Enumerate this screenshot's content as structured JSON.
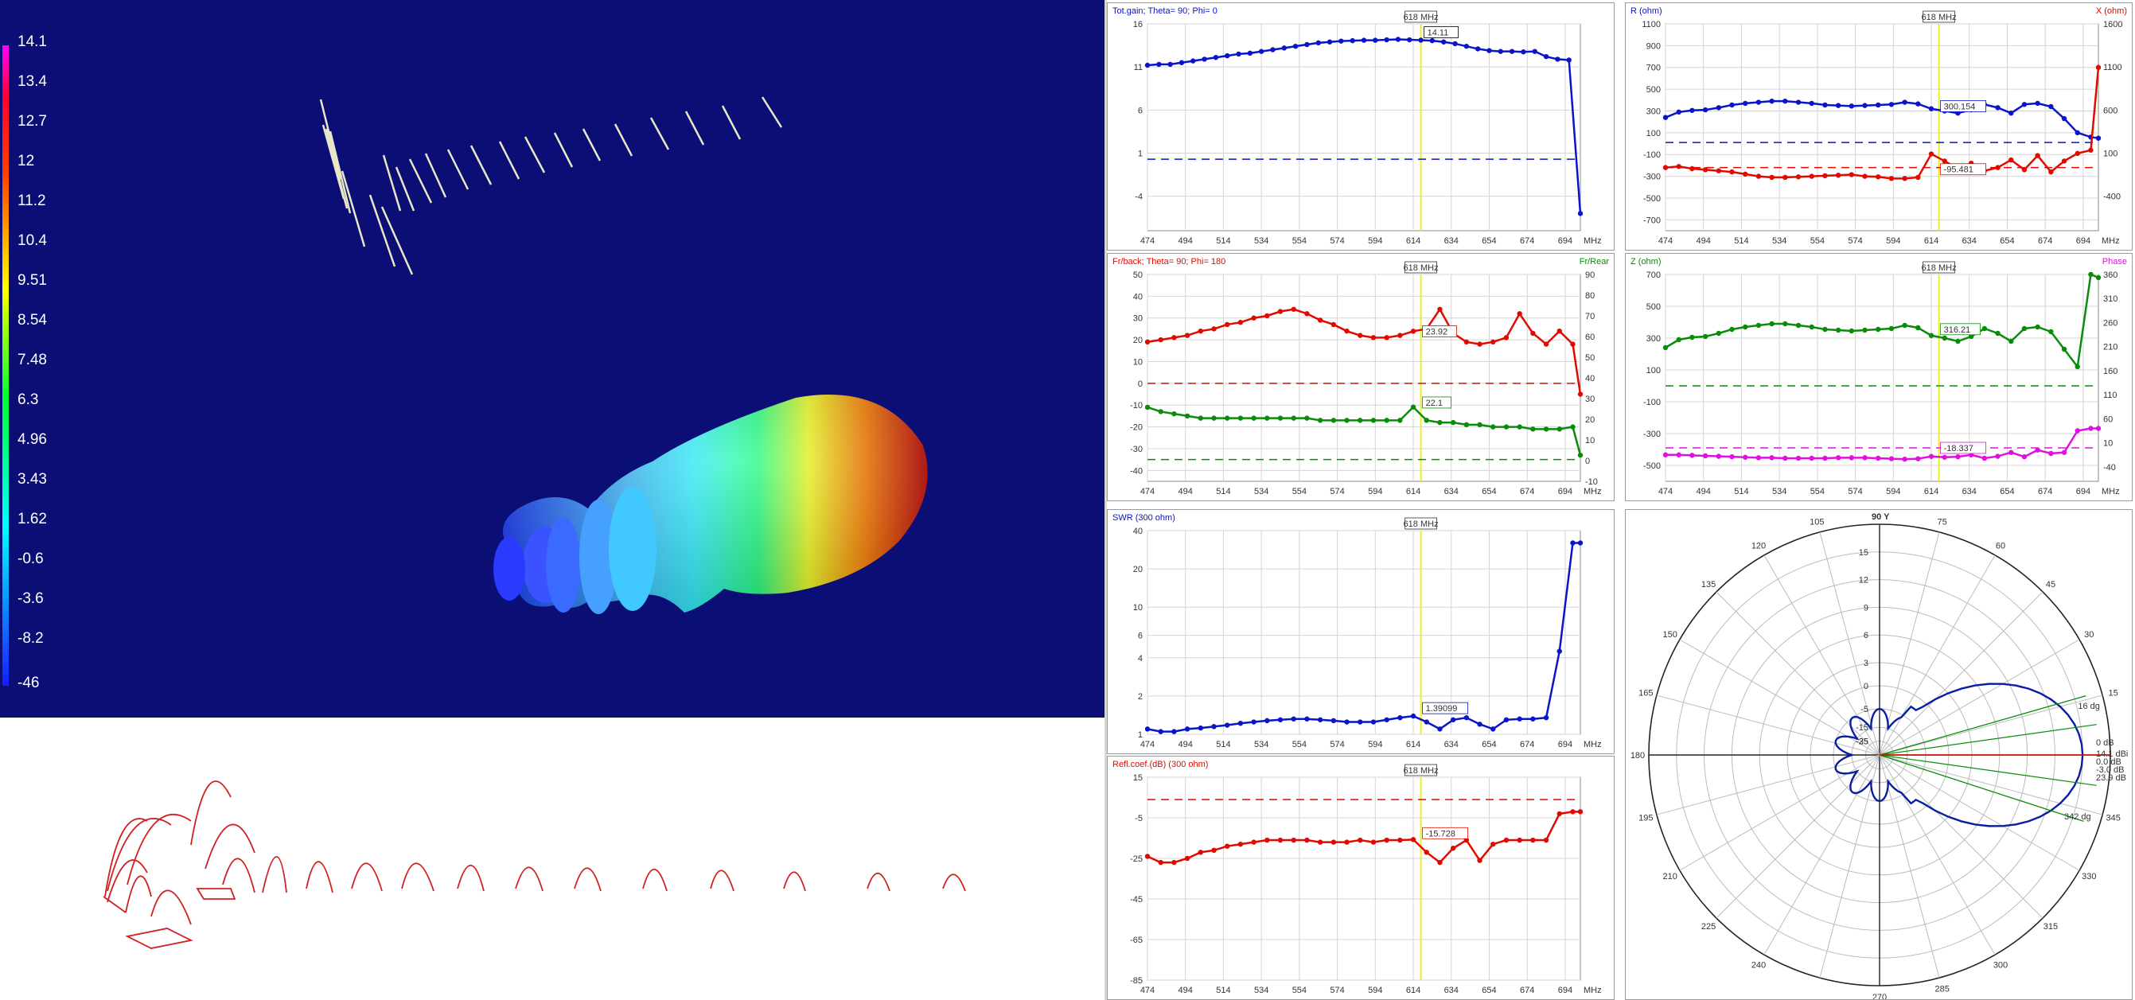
{
  "colors": {
    "background3d": "#0b0e75",
    "blue_series": "#0a14c8",
    "red_series": "#e00a00",
    "green_series": "#0a8c0a",
    "magenta_series": "#e010e0",
    "marker_line": "#f0f020",
    "pattern": "#0a1ea0",
    "wire": "#d02020"
  },
  "colorbar": {
    "labels": [
      "14.1",
      "13.4",
      "12.7",
      "12",
      "11.2",
      "10.4",
      "9.51",
      "8.54",
      "7.48",
      "6.3",
      "4.96",
      "3.43",
      "1.62",
      "-0.6",
      "-3.6",
      "-8.2",
      "-46"
    ]
  },
  "x_axis": {
    "ticks": [
      "474",
      "494",
      "514",
      "534",
      "554",
      "574",
      "594",
      "614",
      "634",
      "654",
      "674",
      "694"
    ],
    "unit": "MHz",
    "marker_label": "618 MHz"
  },
  "panels": {
    "gain": {
      "title": "Tot.gain; Theta= 90; Phi= 0",
      "y_ticks": [
        "16",
        "11",
        "6",
        "1",
        "-4"
      ],
      "readout": "14.11"
    },
    "rx": {
      "title": "R (ohm)",
      "title_right": "X (ohm)",
      "y_ticks_left": [
        "1100",
        "900",
        "700",
        "500",
        "300",
        "100",
        "-100",
        "-300",
        "-500",
        "-700"
      ],
      "y_ticks_right": [
        "1600",
        "1100",
        "600",
        "100",
        "-400"
      ],
      "readout_r": "300.154",
      "readout_x": "-95.481"
    },
    "frback": {
      "title": "Fr/back; Theta= 90; Phi= 180",
      "title_right": "Fr/Rear",
      "y_ticks_left": [
        "50",
        "40",
        "30",
        "20",
        "10",
        "0",
        "-10",
        "-20",
        "-30",
        "-40"
      ],
      "y_ticks_right": [
        "90",
        "80",
        "70",
        "60",
        "50",
        "40",
        "30",
        "20",
        "10",
        "0",
        "-10"
      ],
      "readout_fb": "23.92",
      "readout_fr": "22.1"
    },
    "zphase": {
      "title": "Z (ohm)",
      "title_right": "Phase",
      "y_ticks_left": [
        "700",
        "500",
        "300",
        "100",
        "-100",
        "-300",
        "-500"
      ],
      "y_ticks_right": [
        "360",
        "310",
        "260",
        "210",
        "160",
        "110",
        "60",
        "10",
        "-40"
      ],
      "readout_z": "316.21",
      "readout_phase": "-18.337"
    },
    "swr": {
      "title": "SWR (300 ohm)",
      "y_ticks": [
        "40",
        "20",
        "10",
        "6",
        "4",
        "2",
        "1"
      ],
      "readout": "1.39099"
    },
    "refl": {
      "title": "Refl.coef.(dB) (300 ohm)",
      "y_ticks": [
        "15",
        "-5",
        "-25",
        "-45",
        "-65",
        "-85"
      ],
      "readout": "-15.728"
    },
    "polar": {
      "header": "90 Y",
      "angle_labels": [
        "105",
        "75",
        "120",
        "60",
        "135",
        "45",
        "150",
        "30",
        "165",
        "15",
        "180",
        "195",
        "345",
        "210",
        "330",
        "225",
        "315",
        "240",
        "300",
        "285",
        "270"
      ],
      "radial_labels": [
        "15",
        "12",
        "9",
        "6",
        "3",
        "0",
        "-5",
        "-15",
        "-25",
        "-35"
      ],
      "readouts": [
        "0 dB",
        "14.1 dBi",
        "0.0 dB",
        "-3.0 dB",
        "16 dg",
        "342 dg",
        "23.9 dB"
      ]
    }
  },
  "chart_data": [
    {
      "type": "line",
      "title": "Tot.gain; Theta= 90; Phi= 0",
      "xlabel": "MHz",
      "x": [
        474,
        480,
        486,
        492,
        498,
        504,
        510,
        516,
        522,
        528,
        534,
        540,
        546,
        552,
        558,
        564,
        570,
        576,
        582,
        588,
        594,
        600,
        606,
        612,
        618,
        624,
        630,
        636,
        642,
        648,
        654,
        660,
        666,
        672,
        678,
        684,
        690,
        696,
        702
      ],
      "series": [
        {
          "values": [
            11.2,
            11.3,
            11.3,
            11.5,
            11.7,
            11.9,
            12.1,
            12.3,
            12.5,
            12.6,
            12.8,
            13.0,
            13.2,
            13.4,
            13.6,
            13.8,
            13.9,
            14.0,
            14.05,
            14.1,
            14.1,
            14.15,
            14.2,
            14.15,
            14.11,
            14.05,
            13.9,
            13.7,
            13.4,
            13.1,
            12.9,
            12.8,
            12.8,
            12.75,
            12.8,
            12.2,
            11.9,
            11.8,
            -6.0
          ]
        }
      ],
      "ylim": [
        -8,
        16
      ]
    },
    {
      "type": "line",
      "title": "R (ohm) / X (ohm)",
      "xlabel": "MHz",
      "x": [
        474,
        481,
        488,
        495,
        502,
        509,
        516,
        523,
        530,
        537,
        544,
        551,
        558,
        565,
        572,
        579,
        586,
        593,
        600,
        607,
        614,
        621,
        628,
        635,
        642,
        649,
        656,
        663,
        670,
        677,
        684,
        691,
        698,
        702
      ],
      "series": [
        {
          "name": "R (ohm)",
          "values": [
            240,
            290,
            305,
            310,
            330,
            355,
            370,
            380,
            390,
            390,
            380,
            370,
            355,
            350,
            345,
            350,
            355,
            360,
            380,
            365,
            320,
            300,
            280,
            310,
            360,
            330,
            280,
            360,
            370,
            340,
            230,
            100,
            60,
            50
          ]
        },
        {
          "name": "X (ohm)",
          "values": [
            -220,
            -210,
            -230,
            -240,
            -250,
            -260,
            -280,
            -300,
            -310,
            -310,
            -305,
            -300,
            -295,
            -290,
            -285,
            -300,
            -305,
            -320,
            -320,
            -310,
            -95,
            -160,
            -230,
            -180,
            -250,
            -220,
            -150,
            -240,
            -110,
            -260,
            -160,
            -90,
            -60,
            700
          ]
        }
      ]
    },
    {
      "type": "line",
      "title": "Fr/back; Theta= 90; Phi= 180",
      "xlabel": "MHz",
      "x": [
        474,
        481,
        488,
        495,
        502,
        509,
        516,
        523,
        530,
        537,
        544,
        551,
        558,
        565,
        572,
        579,
        586,
        593,
        600,
        607,
        614,
        621,
        628,
        635,
        642,
        649,
        656,
        663,
        670,
        677,
        684,
        691,
        698,
        702
      ],
      "series": [
        {
          "name": "Fr/back",
          "values": [
            19,
            20,
            21,
            22,
            24,
            25,
            27,
            28,
            30,
            31,
            33,
            34,
            32,
            29,
            27,
            24,
            22,
            21,
            21,
            22,
            23.92,
            25,
            34,
            23,
            19,
            18,
            19,
            21,
            32,
            23,
            18,
            24,
            18,
            -5
          ]
        },
        {
          "name": "Fr/Rear",
          "values": [
            22,
            20,
            19,
            18,
            17,
            17,
            17,
            17,
            17,
            17,
            17,
            17,
            17,
            16,
            16,
            16,
            16,
            16,
            16,
            16,
            22.1,
            16,
            15,
            15,
            14,
            14,
            13,
            13,
            13,
            12,
            12,
            12,
            13,
            0
          ]
        }
      ]
    },
    {
      "type": "line",
      "title": "Z (ohm) / Phase",
      "xlabel": "MHz",
      "x": [
        474,
        481,
        488,
        495,
        502,
        509,
        516,
        523,
        530,
        537,
        544,
        551,
        558,
        565,
        572,
        579,
        586,
        593,
        600,
        607,
        614,
        621,
        628,
        635,
        642,
        649,
        656,
        663,
        670,
        677,
        684,
        691,
        698,
        702
      ],
      "series": [
        {
          "name": "Z (ohm)",
          "values": [
            240,
            290,
            305,
            310,
            330,
            355,
            370,
            380,
            390,
            390,
            380,
            370,
            355,
            350,
            345,
            350,
            355,
            360,
            380,
            365,
            316.21,
            300,
            280,
            310,
            360,
            330,
            280,
            360,
            370,
            340,
            230,
            120,
            700,
            680
          ]
        },
        {
          "name": "Phase",
          "values": [
            -15,
            -15,
            -16,
            -17,
            -18,
            -19,
            -20,
            -21,
            -21,
            -22,
            -22,
            -22,
            -22,
            -21,
            -21,
            -21,
            -22,
            -23,
            -24,
            -23,
            -18.337,
            -20,
            -19,
            -15,
            -22,
            -18,
            -10,
            -19,
            -5,
            -12,
            -10,
            35,
            40,
            40
          ]
        }
      ]
    },
    {
      "type": "line",
      "title": "SWR (300 ohm)",
      "xlabel": "MHz",
      "x": [
        474,
        481,
        488,
        495,
        502,
        509,
        516,
        523,
        530,
        537,
        544,
        551,
        558,
        565,
        572,
        579,
        586,
        593,
        600,
        607,
        614,
        621,
        628,
        635,
        642,
        649,
        656,
        663,
        670,
        677,
        684,
        691,
        698,
        702
      ],
      "series": [
        {
          "values": [
            1.1,
            1.05,
            1.05,
            1.1,
            1.12,
            1.15,
            1.18,
            1.22,
            1.25,
            1.28,
            1.3,
            1.32,
            1.32,
            1.3,
            1.28,
            1.25,
            1.25,
            1.25,
            1.3,
            1.35,
            1.39099,
            1.25,
            1.1,
            1.3,
            1.35,
            1.2,
            1.1,
            1.3,
            1.32,
            1.32,
            1.35,
            4.5,
            32,
            32
          ]
        }
      ],
      "ylim": [
        1,
        40
      ]
    },
    {
      "type": "line",
      "title": "Refl.coef.(dB) (300 ohm)",
      "xlabel": "MHz",
      "x": [
        474,
        481,
        488,
        495,
        502,
        509,
        516,
        523,
        530,
        537,
        544,
        551,
        558,
        565,
        572,
        579,
        586,
        593,
        600,
        607,
        614,
        621,
        628,
        635,
        642,
        649,
        656,
        663,
        670,
        677,
        684,
        691,
        698,
        702
      ],
      "series": [
        {
          "values": [
            -24,
            -27,
            -27,
            -25,
            -22,
            -21,
            -19,
            -18,
            -17,
            -16,
            -16,
            -16,
            -16,
            -17,
            -17,
            -17,
            -16,
            -17,
            -16,
            -16,
            -15.728,
            -22,
            -27,
            -20,
            -16,
            -26,
            -18,
            -16,
            -16,
            -16,
            -16,
            -3,
            -2,
            -2
          ]
        }
      ],
      "ylim": [
        -85,
        15
      ]
    }
  ]
}
